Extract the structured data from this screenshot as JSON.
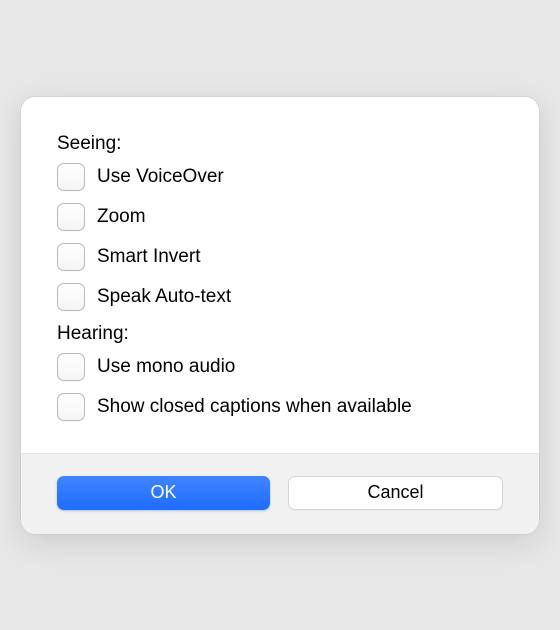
{
  "sections": {
    "seeing": {
      "label": "Seeing:",
      "options": [
        {
          "label": "Use VoiceOver",
          "checked": false
        },
        {
          "label": "Zoom",
          "checked": false
        },
        {
          "label": "Smart Invert",
          "checked": false
        },
        {
          "label": "Speak Auto-text",
          "checked": false
        }
      ]
    },
    "hearing": {
      "label": "Hearing:",
      "options": [
        {
          "label": "Use mono audio",
          "checked": false
        },
        {
          "label": "Show closed captions when available",
          "checked": false
        }
      ]
    }
  },
  "buttons": {
    "ok": "OK",
    "cancel": "Cancel"
  }
}
